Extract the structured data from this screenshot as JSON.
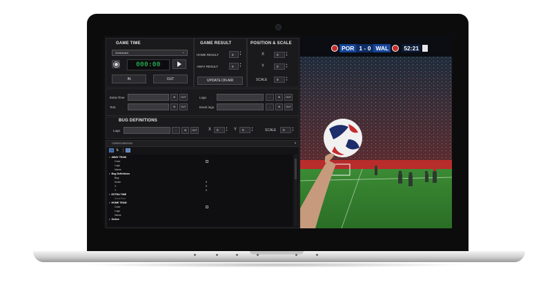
{
  "game_time": {
    "title": "GAME TIME",
    "mode_select": "Scheduled",
    "timer": "000:00",
    "in_label": "IN",
    "out_label": "OUT"
  },
  "game_result": {
    "title": "GAME RESULT",
    "home_label": "HOME RESULT",
    "home_value": "0",
    "away_label": "AWAY RESULT",
    "away_value": "0",
    "update_label": "UPDATE ON AIR"
  },
  "position_scale": {
    "title": "POSITION & SCALE",
    "x_label": "X",
    "x_value": "0",
    "y_label": "Y",
    "y_value": "0",
    "scale_label": "SCALE",
    "scale_value": "0"
  },
  "extras": {
    "extra_time_label": "Extra Time",
    "text_label": "Text",
    "logo_label": "Logo",
    "event_logo_label": "Event logo",
    "in_label": "IN",
    "out_label": "OUT",
    "browse_label": "..."
  },
  "bug_definitions": {
    "title": "BUG DEFINITIONS",
    "logo_label": "Logo",
    "browse_label": "...",
    "in_label": "IN",
    "out_label": "OUT",
    "x_label": "X",
    "x_value": "0",
    "y_label": "Y",
    "y_value": "0",
    "scale_label": "SCALE",
    "scale_value": "0"
  },
  "configuration": {
    "title": "CONFIGURATION",
    "rows": {
      "away_team": "AWAY TEAM",
      "away_color": "Color",
      "away_logo": "Logo",
      "away_name": "Name",
      "bug_definitions": "Bug Definitions",
      "bug": "Bug",
      "scale": "Scale",
      "scale_value": "0",
      "x": "X",
      "x_value": "0",
      "y": "Y",
      "y_value": "0",
      "extra_time": "EXTRA TIME",
      "extra_time_sub": "ExtraTime",
      "home_team": "HOME TEAM",
      "home_color": "Color",
      "home_logo": "Logo",
      "home_name": "Name",
      "online": "Online"
    }
  },
  "scorebug": {
    "home_team": "POR",
    "score": "1 - 0",
    "away_team": "WAL",
    "clock": "52:21"
  },
  "colors": {
    "screen_bg": "#000000",
    "panel_bg": "#1a1a1c",
    "timer_green": "#2ee06a",
    "pitch_green": "#2f7a2a",
    "scorebug_blue": "#16459a"
  },
  "icons": [
    "settings-icon",
    "play-icon",
    "sort-categorized-icon",
    "sort-alpha-icon",
    "property-pages-icon"
  ]
}
